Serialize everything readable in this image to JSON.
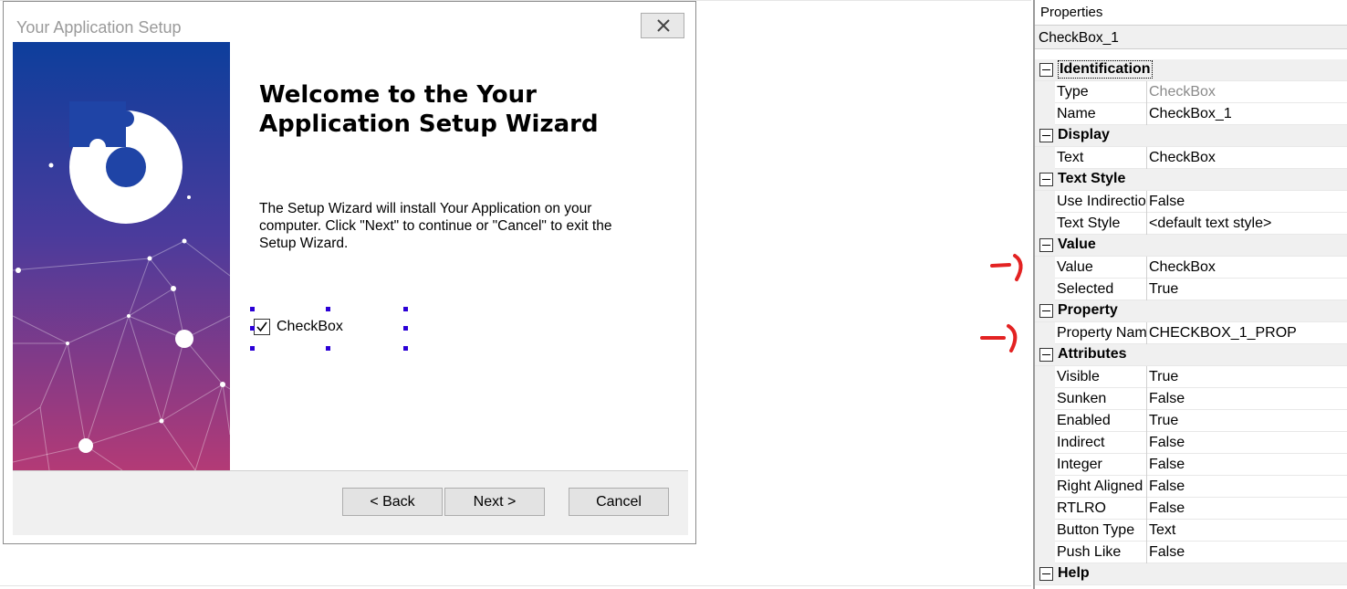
{
  "dialog": {
    "title": "Your Application Setup",
    "welcome_title": "Welcome to the Your Application Setup Wizard",
    "welcome_text": "The Setup Wizard will install Your Application on your computer.  Click \"Next\" to continue or \"Cancel\" to exit the Setup Wizard.",
    "checkbox_label": "CheckBox",
    "checkbox_checked": true,
    "buttons": {
      "back": "< Back",
      "next": "Next >",
      "cancel": "Cancel"
    }
  },
  "properties": {
    "header": "Properties",
    "object_name": "CheckBox_1",
    "categories": [
      {
        "label": "Identification",
        "rows": [
          {
            "name": "Type",
            "value": "CheckBox",
            "readonly": true
          },
          {
            "name": "Name",
            "value": "CheckBox_1"
          }
        ]
      },
      {
        "label": "Display",
        "rows": [
          {
            "name": "Text",
            "value": "CheckBox"
          }
        ]
      },
      {
        "label": "Text Style",
        "rows": [
          {
            "name": "Use Indirection",
            "value": "False"
          },
          {
            "name": "Text Style",
            "value": "<default text style>"
          }
        ]
      },
      {
        "label": "Value",
        "rows": [
          {
            "name": "Value",
            "value": "CheckBox"
          },
          {
            "name": "Selected",
            "value": "True"
          }
        ]
      },
      {
        "label": "Property",
        "rows": [
          {
            "name": "Property Name",
            "value": "CHECKBOX_1_PROP"
          }
        ]
      },
      {
        "label": "Attributes",
        "rows": [
          {
            "name": "Visible",
            "value": "True"
          },
          {
            "name": "Sunken",
            "value": "False"
          },
          {
            "name": "Enabled",
            "value": "True"
          },
          {
            "name": "Indirect",
            "value": "False"
          },
          {
            "name": "Integer",
            "value": "False"
          },
          {
            "name": "Right Aligned",
            "value": "False"
          },
          {
            "name": "RTLRO",
            "value": "False"
          },
          {
            "name": "Button Type",
            "value": "Text"
          },
          {
            "name": "Push Like",
            "value": "False"
          }
        ]
      },
      {
        "label": "Help",
        "rows": []
      }
    ]
  },
  "colors": {
    "selection_handle": "#2b00d6",
    "annotation_arrow": "#e32222",
    "banner_top": "#0d3e9c",
    "banner_bottom": "#b33a76"
  }
}
